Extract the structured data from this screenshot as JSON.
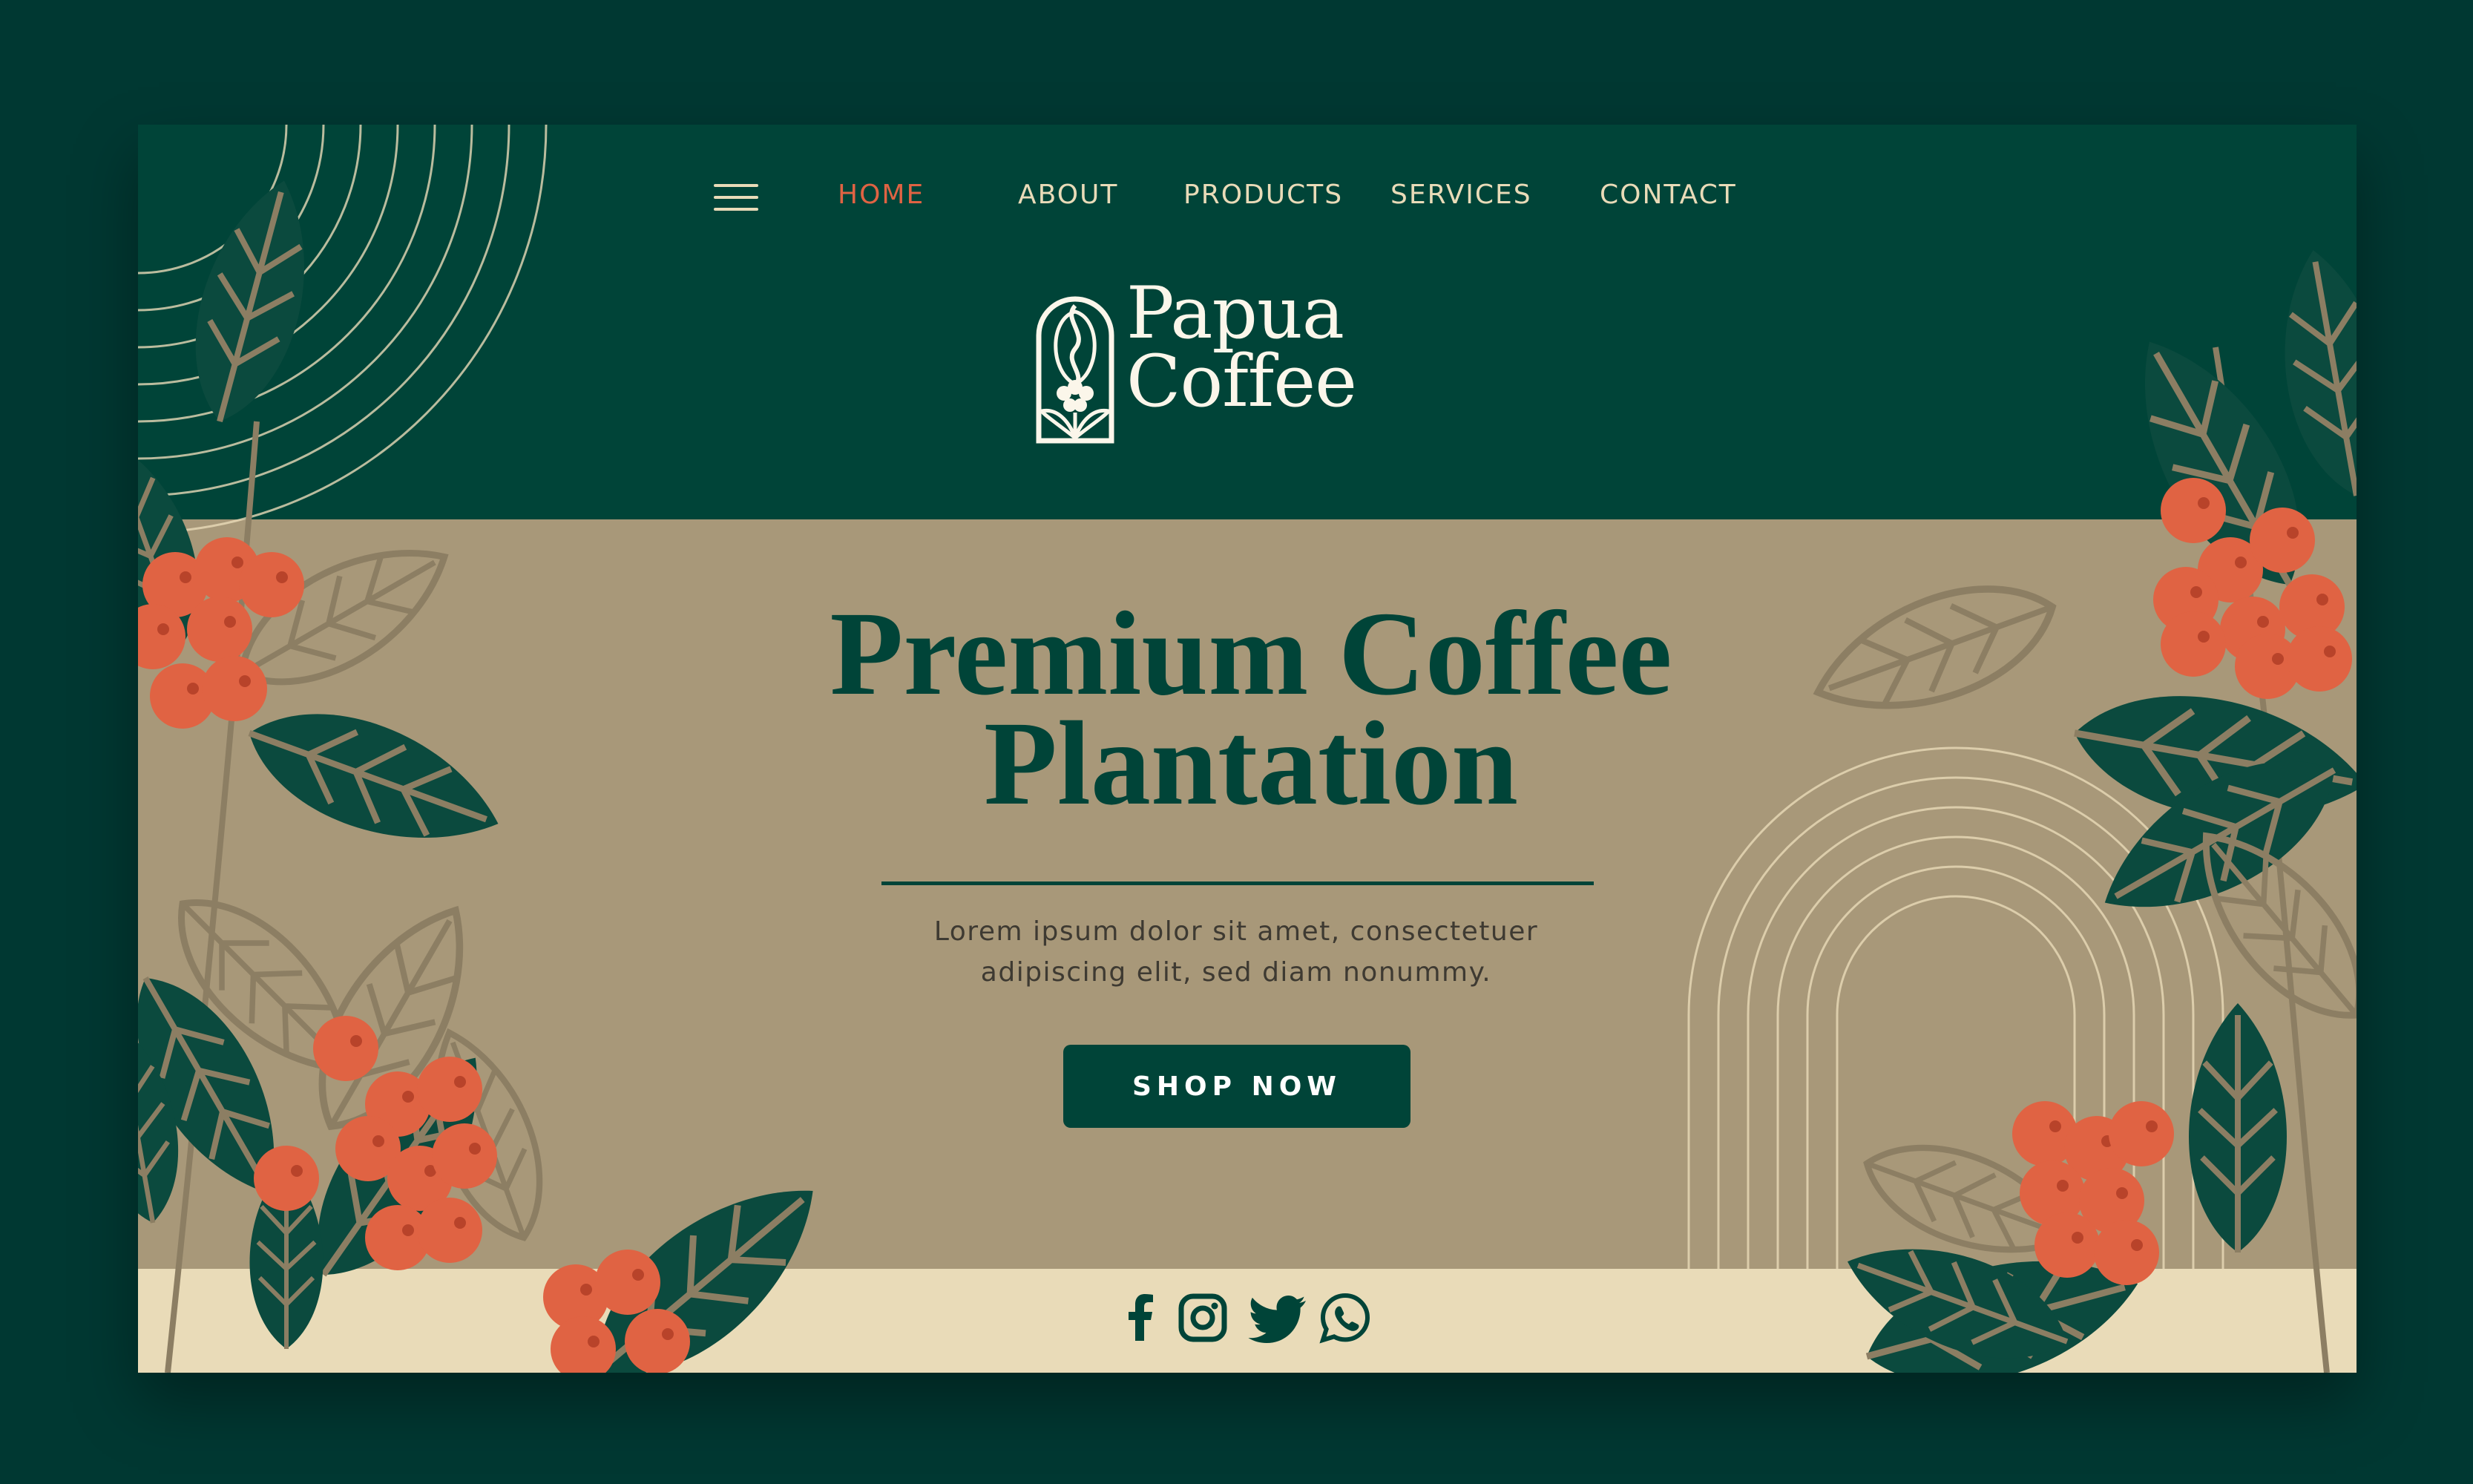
{
  "nav": {
    "items": [
      {
        "label": "HOME",
        "active": true
      },
      {
        "label": "ABOUT",
        "active": false
      },
      {
        "label": "PRODUCTS",
        "active": false
      },
      {
        "label": "SERVICES",
        "active": false
      },
      {
        "label": "CONTACT",
        "active": false
      }
    ],
    "menu_icon": "hamburger-menu-icon"
  },
  "brand": {
    "line1": "Papua",
    "line2": "Coffee",
    "logo_icon": "coffee-bean-arch-logo"
  },
  "hero": {
    "title_line1": "Premium Coffee",
    "title_line2": "Plantation",
    "subtitle_line1": "Lorem ipsum dolor sit amet, consectetuer",
    "subtitle_line2": "adipiscing elit, sed diam nonummy.",
    "cta_label": "SHOP NOW"
  },
  "social": [
    {
      "icon": "facebook-icon"
    },
    {
      "icon": "instagram-icon"
    },
    {
      "icon": "twitter-icon"
    },
    {
      "icon": "whatsapp-icon"
    }
  ],
  "colors": {
    "page_bg": "#003832",
    "dark_green": "#004438",
    "khaki": "#a89879",
    "cream": "#e9dbb8",
    "accent_orange": "#e06343",
    "leaf_green": "#0b4a3e"
  }
}
